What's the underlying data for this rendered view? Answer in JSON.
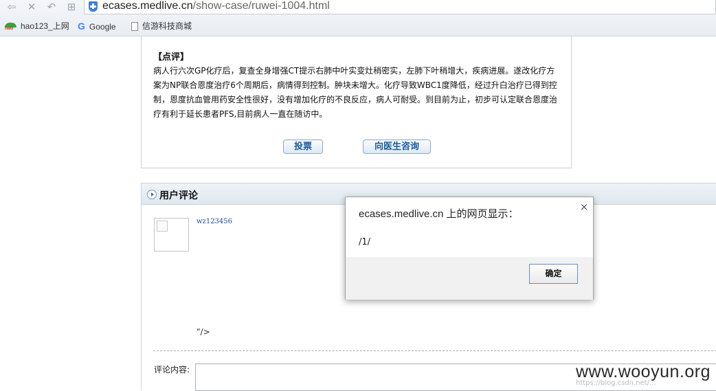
{
  "browser": {
    "url_host": "ecases.medlive.cn",
    "url_path": "/show-case/ruwei-1004.html",
    "bookmarks": [
      {
        "label": "hao123_上网",
        "icon": "hao123-icon"
      },
      {
        "label": "Google",
        "icon": "google-icon"
      },
      {
        "label": "信游科技商城",
        "icon": "page-icon"
      }
    ]
  },
  "review": {
    "title": "【点评】",
    "body": "病人行六次GP化疗后，复查全身增强CT提示右肺中叶实变灶稍密实，左肺下叶稍增大，疾病进展。遂改化疗方案为NP联合恩度治疗6个周期后，病情得到控制。肿块未增大。化疗导致WBC1度降低，经过升白治疗已得到控制，恩度抗血管用药安全性很好，没有增加化疗的不良反应，病人可耐受。到目前为止，初步可认定联合恩度治疗有利于延长患者PFS,目前病人一直在随访中。",
    "vote_label": "投票",
    "consult_label": "向医生咨询"
  },
  "comments": {
    "title": "用户评论",
    "username": "wz123456",
    "stray_text": "\"/>",
    "content_label": "评论内容:"
  },
  "dialog": {
    "title": "ecases.medlive.cn 上的网页显示：",
    "message": "/1/",
    "ok_label": "确定",
    "close_glyph": "×"
  },
  "watermark": {
    "text": "www.wooyun.org",
    "sub": "https://blog.csdn.net/..."
  }
}
